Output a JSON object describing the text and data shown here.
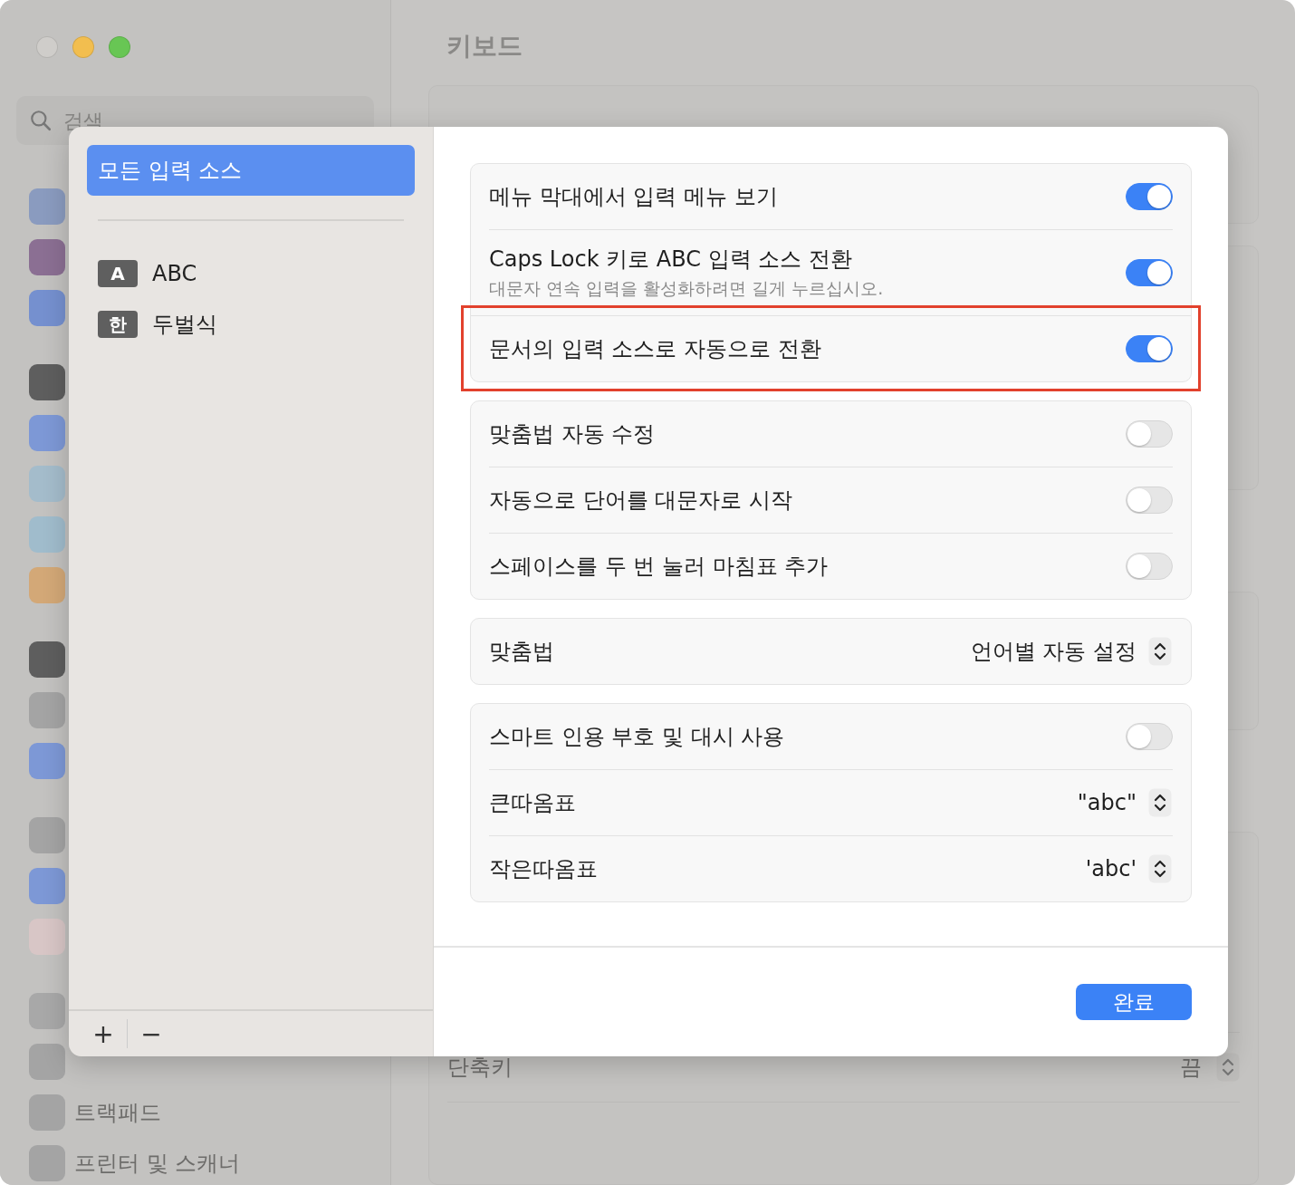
{
  "background": {
    "search": {
      "placeholder": "검색"
    },
    "sidebar_items": [
      {
        "label": "트랙패드"
      },
      {
        "label": "프린터 및 스캐너"
      }
    ],
    "title": "키보드",
    "rows": [
      {
        "label": "단축키",
        "value": "끔"
      }
    ]
  },
  "sheet": {
    "sources": [
      {
        "label": "모든 입력 소스",
        "selected": true
      }
    ],
    "input_sources": [
      {
        "badge": "A",
        "label": "ABC",
        "selected": false
      },
      {
        "badge": "한",
        "label": "두벌식",
        "selected": false
      }
    ],
    "add_button": "+",
    "remove_button": "−",
    "groups": [
      {
        "rows": [
          {
            "kind": "toggle",
            "label": "메뉴 막대에서 입력 메뉴 보기",
            "on": true,
            "highlighted": false
          },
          {
            "kind": "toggle",
            "label": "Caps Lock 키로 ABC 입력 소스 전환",
            "subtitle": "대문자 연속 입력을 활성화하려면 길게 누르십시오.",
            "on": true,
            "highlighted": false
          },
          {
            "kind": "toggle",
            "label": "문서의 입력 소스로 자동으로 전환",
            "on": true,
            "highlighted": true
          }
        ]
      },
      {
        "rows": [
          {
            "kind": "toggle",
            "label": "맞춤법 자동 수정",
            "on": false,
            "highlighted": false
          },
          {
            "kind": "toggle",
            "label": "자동으로 단어를 대문자로 시작",
            "on": false,
            "highlighted": false
          },
          {
            "kind": "toggle",
            "label": "스페이스를 두 번 눌러 마침표 추가",
            "on": false,
            "highlighted": false
          }
        ]
      },
      {
        "rows": [
          {
            "kind": "select",
            "label": "맞춤법",
            "value": "언어별 자동 설정",
            "highlighted": false
          }
        ]
      },
      {
        "rows": [
          {
            "kind": "toggle",
            "label": "스마트 인용 부호 및 대시 사용",
            "on": false,
            "highlighted": false
          },
          {
            "kind": "select",
            "label": "큰따옴표",
            "value": "\"abc\"",
            "highlighted": false
          },
          {
            "kind": "select",
            "label": "작은따옴표",
            "value": "'abc'",
            "highlighted": false
          }
        ]
      }
    ],
    "done_button": "완료"
  }
}
